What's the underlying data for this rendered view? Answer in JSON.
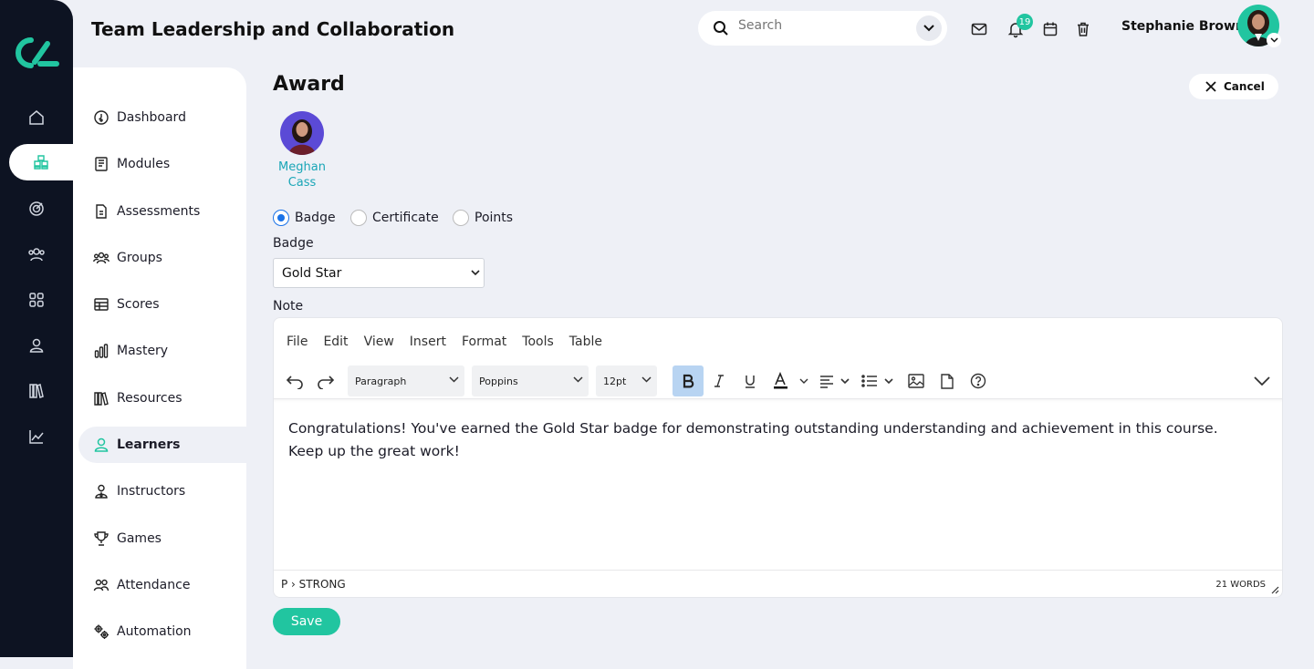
{
  "header": {
    "title": "Team Leadership and Collaboration",
    "search_placeholder": "Search",
    "notification_count": "19",
    "user_name": "Stephanie Brown"
  },
  "rail": {
    "icons": [
      "home-icon",
      "modules-cubes-icon",
      "target-icon",
      "users-icon",
      "grid-icon",
      "person-icon",
      "library-icon",
      "chart-icon"
    ],
    "active_index": 1
  },
  "sidebar": {
    "items": [
      {
        "label": "Dashboard",
        "icon": "dashboard-icon"
      },
      {
        "label": "Modules",
        "icon": "book-icon"
      },
      {
        "label": "Assessments",
        "icon": "document-icon"
      },
      {
        "label": "Groups",
        "icon": "group-icon"
      },
      {
        "label": "Scores",
        "icon": "table-icon"
      },
      {
        "label": "Mastery",
        "icon": "bar-chart-icon"
      },
      {
        "label": "Resources",
        "icon": "library-icon"
      },
      {
        "label": "Learners",
        "icon": "user-icon"
      },
      {
        "label": "Instructors",
        "icon": "instructor-icon"
      },
      {
        "label": "Games",
        "icon": "trophy-icon"
      },
      {
        "label": "Attendance",
        "icon": "attendance-icon"
      },
      {
        "label": "Automation",
        "icon": "gears-icon"
      }
    ],
    "active": "Learners"
  },
  "page": {
    "title": "Award",
    "cancel_label": "Cancel",
    "learner_name_first": "Meghan",
    "learner_name_last": "Cass",
    "award_types": [
      "Badge",
      "Certificate",
      "Points"
    ],
    "selected_award_type": "Badge",
    "badge_label": "Badge",
    "badge_value": "Gold Star",
    "note_label": "Note",
    "save_label": "Save"
  },
  "editor": {
    "menu": [
      "File",
      "Edit",
      "View",
      "Insert",
      "Format",
      "Tools",
      "Table"
    ],
    "block_format": "Paragraph",
    "font_family": "Poppins",
    "font_size": "12pt",
    "content_line1": "Congratulations! You've earned the Gold Star badge for demonstrating outstanding understanding and achievement in this course.",
    "content_line2": "Keep up the great work!",
    "path": "P › STRONG",
    "word_count": "21 WORDS"
  },
  "colors": {
    "accent": "#21c5a0",
    "rail_bg": "#0d1322",
    "page_bg": "#eef0f6",
    "link": "#1aa6b7",
    "radio_selected": "#1a73e8",
    "bold_active": "#b8d4f2"
  }
}
